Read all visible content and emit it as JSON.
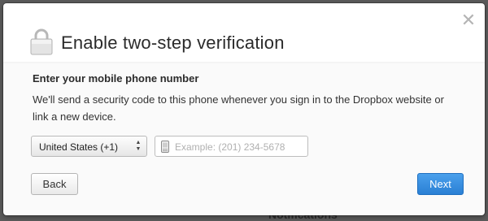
{
  "background": {
    "partial_text": "Notifications"
  },
  "dialog": {
    "title": "Enable two-step verification",
    "close_icon": "close-icon",
    "lock_icon": "lock-icon",
    "section_heading": "Enter your mobile phone number",
    "description": "We'll send a security code to this phone whenever you sign in to the Dropbox website or link a new device.",
    "country_select": {
      "selected": "United States (+1)"
    },
    "phone_input": {
      "placeholder": "Example: (201) 234-5678",
      "value": "",
      "icon": "mobile-phone-icon"
    },
    "buttons": {
      "back": "Back",
      "next": "Next"
    }
  },
  "colors": {
    "primary_button": "#2f86dc",
    "overlay": "#5a5a5a"
  }
}
